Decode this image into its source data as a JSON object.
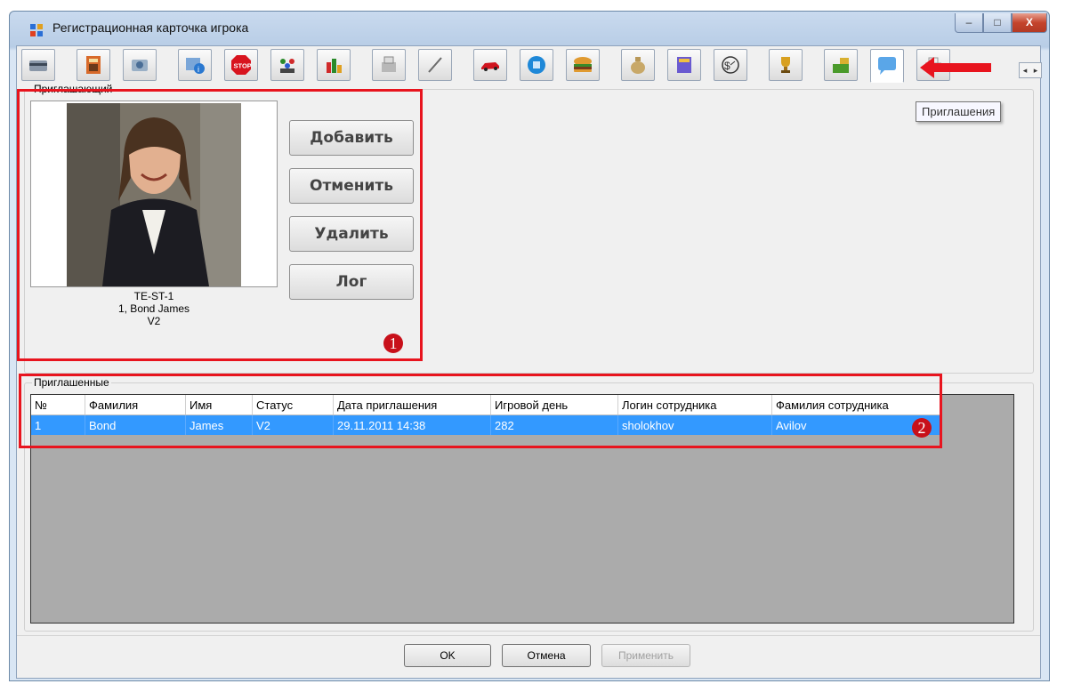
{
  "window": {
    "title": "Регистрационная карточка игрока",
    "controls": {
      "minimize": "–",
      "maximize": "□",
      "close": "X"
    }
  },
  "toolbar": {
    "tabs": [
      "card-icon",
      "calculator-icon",
      "camera-icon",
      "info-card-icon",
      "stop-icon",
      "people-icon",
      "bar-chart-icon",
      "cash-register-icon",
      "pen-icon",
      "car-icon",
      "coin-button-icon",
      "burger-icon",
      "money-bag-icon",
      "books-icon",
      "clock-dollar-icon",
      "trophy-icon",
      "money-hand-icon",
      "speech-bubble-icon",
      "printer-icon"
    ],
    "active_tab": "speech-bubble-icon",
    "tooltip": "Приглашения",
    "scroll": {
      "left": "◂",
      "right": "▸"
    }
  },
  "inviter": {
    "group_label": "Приглашающий",
    "caption": [
      "TE-ST-1",
      "1, Bond James",
      "V2"
    ],
    "buttons": {
      "add": "Добавить",
      "cancel": "Отменить",
      "delete": "Удалить",
      "log": "Лог"
    },
    "badge": "1"
  },
  "invited": {
    "group_label": "Приглашенные",
    "badge": "2",
    "columns": [
      "№",
      "Фамилия",
      "Имя",
      "Статус",
      "Дата приглашения",
      "Игровой день",
      "Логин сотрудника",
      "Фамилия сотрудника"
    ],
    "rows": [
      [
        "1",
        "Bond",
        "James",
        "V2",
        "29.11.2011 14:38",
        "282",
        "sholokhov",
        "Avilov"
      ]
    ]
  },
  "footer": {
    "ok": "OK",
    "cancel": "Отмена",
    "apply": "Применить"
  },
  "colors": {
    "highlight": "#e8141e",
    "selection": "#3399ff",
    "grid_bg": "#ababab"
  }
}
